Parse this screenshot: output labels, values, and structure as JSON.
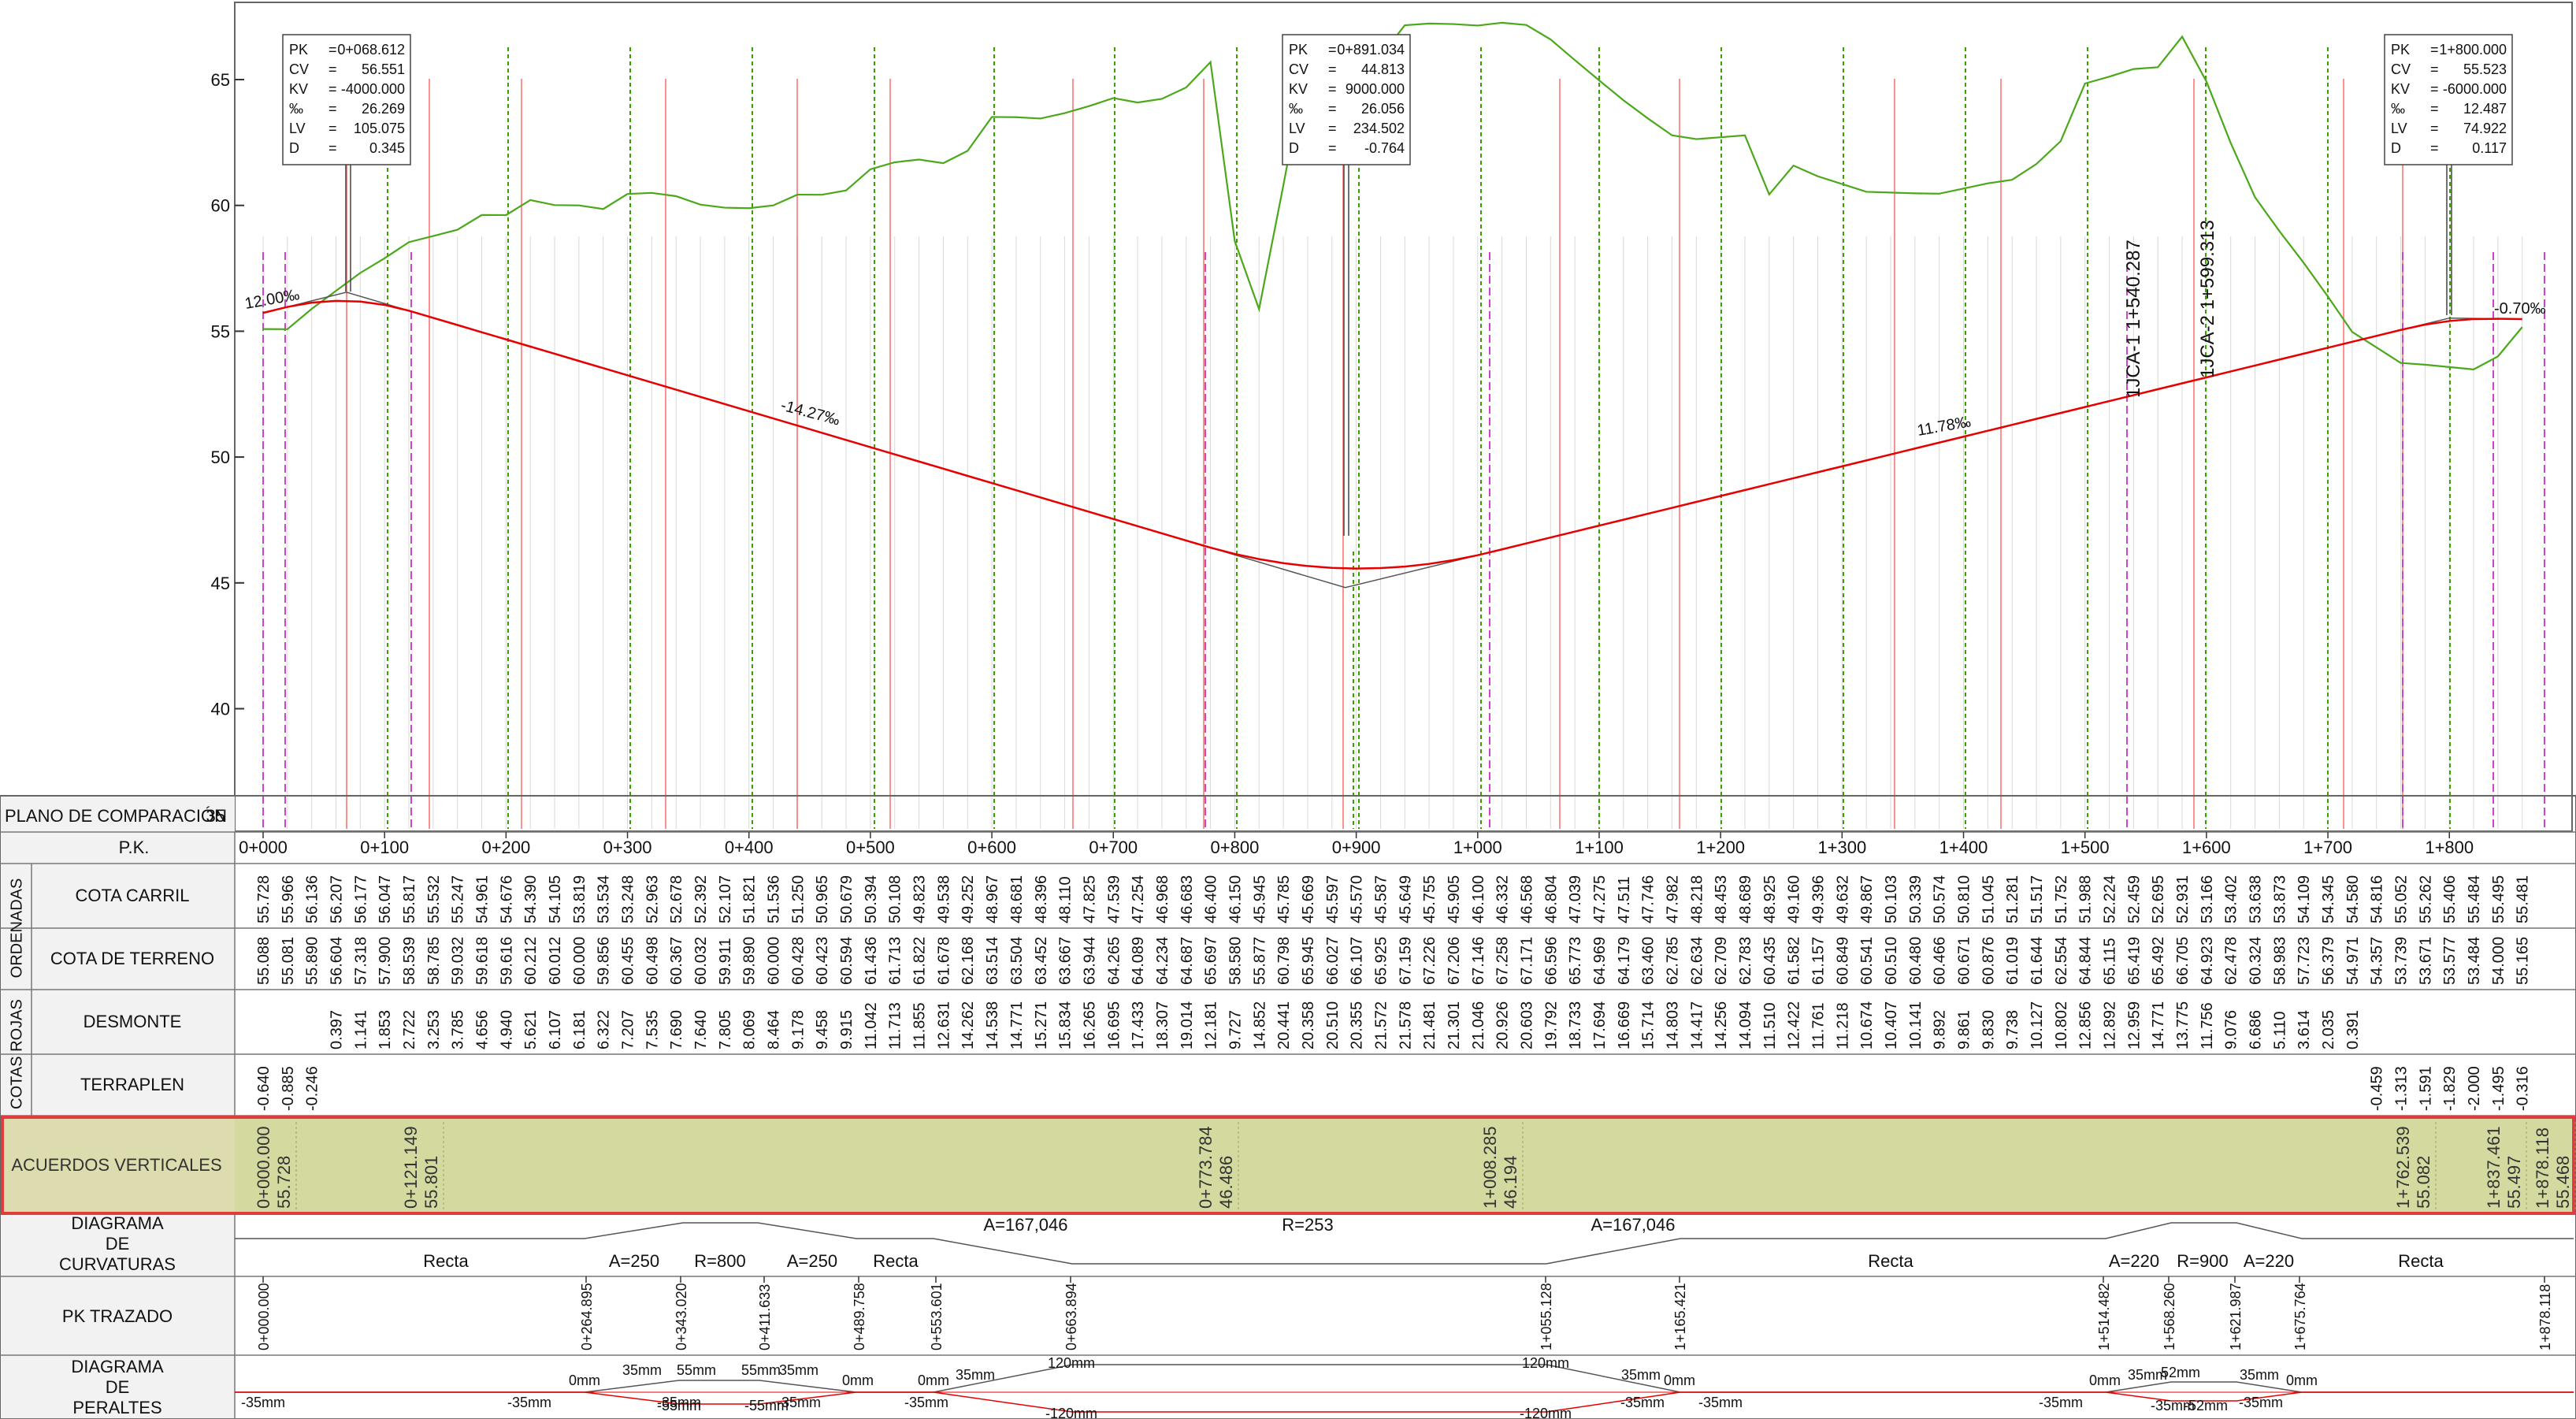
{
  "profile": {
    "y_axis_ticks": [
      "40",
      "45",
      "50",
      "55",
      "60",
      "65"
    ],
    "grade_labels": [
      "12.00‰",
      "-14.27‰",
      "11.78‰",
      "-0.70‰"
    ],
    "rotated_labels": [
      "1JCA-1 1+540.287",
      "1JCA-2 1+599.313"
    ],
    "callouts": [
      {
        "rows": [
          [
            "PK",
            "0+068.612"
          ],
          [
            "CV",
            "56.551"
          ],
          [
            "KV",
            "-4000.000"
          ],
          [
            "‰",
            "26.269"
          ],
          [
            "LV",
            "105.075"
          ],
          [
            "D",
            "0.345"
          ]
        ]
      },
      {
        "rows": [
          [
            "PK",
            "0+891.034"
          ],
          [
            "CV",
            "44.813"
          ],
          [
            "KV",
            "9000.000"
          ],
          [
            "‰",
            "26.056"
          ],
          [
            "LV",
            "234.502"
          ],
          [
            "D",
            "-0.764"
          ]
        ]
      },
      {
        "rows": [
          [
            "PK",
            "1+800.000"
          ],
          [
            "CV",
            "55.523"
          ],
          [
            "KV",
            "-6000.000"
          ],
          [
            "‰",
            "12.487"
          ],
          [
            "LV",
            "74.922"
          ],
          [
            "D",
            "0.117"
          ]
        ]
      }
    ]
  },
  "guitar": {
    "plano_label": "PLANO DE COMPARACIÓN",
    "plano_value": "35",
    "pk_header": "P.K.",
    "pk_labels": [
      "0+000",
      "0+100",
      "0+200",
      "0+300",
      "0+400",
      "0+500",
      "0+600",
      "0+700",
      "0+800",
      "0+900",
      "1+000",
      "1+100",
      "1+200",
      "1+300",
      "1+400",
      "1+500",
      "1+600",
      "1+700",
      "1+800"
    ],
    "group_ordenadas": "ORDENADAS",
    "group_cotas_rojas": "COTAS ROJAS",
    "row_labels": {
      "cota_carril": "COTA CARRIL",
      "cota_terreno": "COTA DE TERRENO",
      "desmonte": "DESMONTE",
      "terraplen": "TERRAPLEN",
      "acuerdos": "ACUERDOS VERTICALES",
      "curvaturas": "DIAGRAMA\nDE\nCURVATURAS",
      "pk_trazado": "PK TRAZADO",
      "peraltes": "DIAGRAMA\nDE\nPERALTES"
    },
    "cota_carril": [
      "55.728",
      "55.966",
      "56.136",
      "56.207",
      "56.177",
      "56.047",
      "55.817",
      "55.532",
      "55.247",
      "54.961",
      "54.676",
      "54.390",
      "54.105",
      "53.819",
      "53.534",
      "53.248",
      "52.963",
      "52.678",
      "52.392",
      "52.107",
      "51.821",
      "51.536",
      "51.250",
      "50.965",
      "50.679",
      "50.394",
      "50.108",
      "49.823",
      "49.538",
      "49.252",
      "48.967",
      "48.681",
      "48.396",
      "48.110",
      "47.825",
      "47.539",
      "47.254",
      "46.968",
      "46.683",
      "46.400",
      "46.150",
      "45.945",
      "45.785",
      "45.669",
      "45.597",
      "45.570",
      "45.587",
      "45.649",
      "45.755",
      "45.905",
      "46.100",
      "46.332",
      "46.568",
      "46.804",
      "47.039",
      "47.275",
      "47.511",
      "47.746",
      "47.982",
      "48.218",
      "48.453",
      "48.689",
      "48.925",
      "49.160",
      "49.396",
      "49.632",
      "49.867",
      "50.103",
      "50.339",
      "50.574",
      "50.810",
      "51.045",
      "51.281",
      "51.517",
      "51.752",
      "51.988",
      "52.224",
      "52.459",
      "52.695",
      "52.931",
      "53.166",
      "53.402",
      "53.638",
      "53.873",
      "54.109",
      "54.345",
      "54.580",
      "54.816",
      "55.052",
      "55.262",
      "55.406",
      "55.484",
      "55.495",
      "55.481"
    ],
    "cota_terreno": [
      "55.088",
      "55.081",
      "55.890",
      "56.604",
      "57.318",
      "57.900",
      "58.539",
      "58.785",
      "59.032",
      "59.618",
      "59.616",
      "60.212",
      "60.012",
      "60.000",
      "59.856",
      "60.455",
      "60.498",
      "60.367",
      "60.032",
      "59.911",
      "59.890",
      "60.000",
      "60.428",
      "60.423",
      "60.594",
      "61.436",
      "61.713",
      "61.822",
      "61.678",
      "62.168",
      "63.514",
      "63.504",
      "63.452",
      "63.667",
      "63.944",
      "64.265",
      "64.089",
      "64.234",
      "64.687",
      "65.697",
      "58.580",
      "55.877",
      "60.798",
      "65.945",
      "66.027",
      "66.107",
      "65.925",
      "67.159",
      "67.226",
      "67.206",
      "67.146",
      "67.258",
      "67.171",
      "66.596",
      "65.773",
      "64.969",
      "64.179",
      "63.460",
      "62.785",
      "62.634",
      "62.709",
      "62.783",
      "60.435",
      "61.582",
      "61.157",
      "60.849",
      "60.541",
      "60.510",
      "60.480",
      "60.466",
      "60.671",
      "60.876",
      "61.019",
      "61.644",
      "62.554",
      "64.844",
      "65.115",
      "65.419",
      "65.492",
      "66.705",
      "64.923",
      "62.478",
      "60.324",
      "58.983",
      "57.723",
      "56.379",
      "54.971",
      "54.357",
      "53.739",
      "53.671",
      "53.577",
      "53.484",
      "54.000",
      "55.165"
    ],
    "desmonte": [
      null,
      null,
      null,
      "0.397",
      "1.141",
      "1.853",
      "2.722",
      "3.253",
      "3.785",
      "4.656",
      "4.940",
      "5.621",
      "6.107",
      "6.181",
      "6.322",
      "7.207",
      "7.535",
      "7.690",
      "7.640",
      "7.805",
      "8.069",
      "8.464",
      "9.178",
      "9.458",
      "9.915",
      "11.042",
      "11.713",
      "11.855",
      "12.631",
      "14.262",
      "14.538",
      "14.771",
      "15.271",
      "15.834",
      "16.265",
      "16.695",
      "17.433",
      "18.307",
      "19.014",
      "12.181",
      "9.727",
      "14.852",
      "20.441",
      "20.358",
      "20.510",
      "20.355",
      "21.572",
      "21.578",
      "21.481",
      "21.301",
      "21.046",
      "20.926",
      "20.603",
      "19.792",
      "18.733",
      "17.694",
      "16.669",
      "15.714",
      "14.803",
      "14.417",
      "14.256",
      "14.094",
      "11.510",
      "12.422",
      "11.761",
      "11.218",
      "10.674",
      "10.407",
      "10.141",
      "9.892",
      "9.861",
      "9.830",
      "9.738",
      "10.127",
      "10.802",
      "12.856",
      "12.892",
      "12.959",
      "14.771",
      "13.775",
      "11.756",
      "9.076",
      "6.686",
      "5.110",
      "3.614",
      "2.035",
      "0.391",
      null,
      null,
      null,
      null,
      null,
      null,
      null
    ],
    "terraplen_start": [
      "-0.640",
      "-0.885",
      "-0.246"
    ],
    "terraplen_end": [
      "-0.459",
      "-1.313",
      "-1.591",
      "-1.829",
      "-2.000",
      "-1.495",
      "-0.316"
    ],
    "acuerdos": [
      [
        "0+000.000",
        "55.728"
      ],
      [
        "0+121.149",
        "55.801"
      ],
      [
        "0+773.784",
        "46.486"
      ],
      [
        "1+008.285",
        "46.194"
      ],
      [
        "1+762.539",
        "55.082"
      ],
      [
        "1+837.461",
        "55.497"
      ],
      [
        "1+878.118",
        "55.468"
      ]
    ],
    "curvaturas": {
      "recta": "Recta",
      "a250": "A=250",
      "r800": "R=800",
      "a167": "A=167,046",
      "r253": "R=253",
      "a220": "A=220",
      "r900": "R=900"
    },
    "pk_trazado": [
      "0+000.000",
      "0+264.895",
      "0+343.020",
      "0+411.633",
      "0+489.758",
      "0+553.601",
      "0+663.894",
      "1+055.128",
      "1+165.421",
      "1+514.482",
      "1+568.260",
      "1+621.987",
      "1+675.764",
      "1+878.118"
    ],
    "peraltes": {
      "neg35": "-35mm",
      "zero": "0mm",
      "p35": "35mm",
      "p55": "55mm",
      "neg55": "-55mm",
      "p120": "120mm",
      "neg120": "-120mm",
      "p52": "52mm",
      "neg52": "-52mm"
    }
  }
}
